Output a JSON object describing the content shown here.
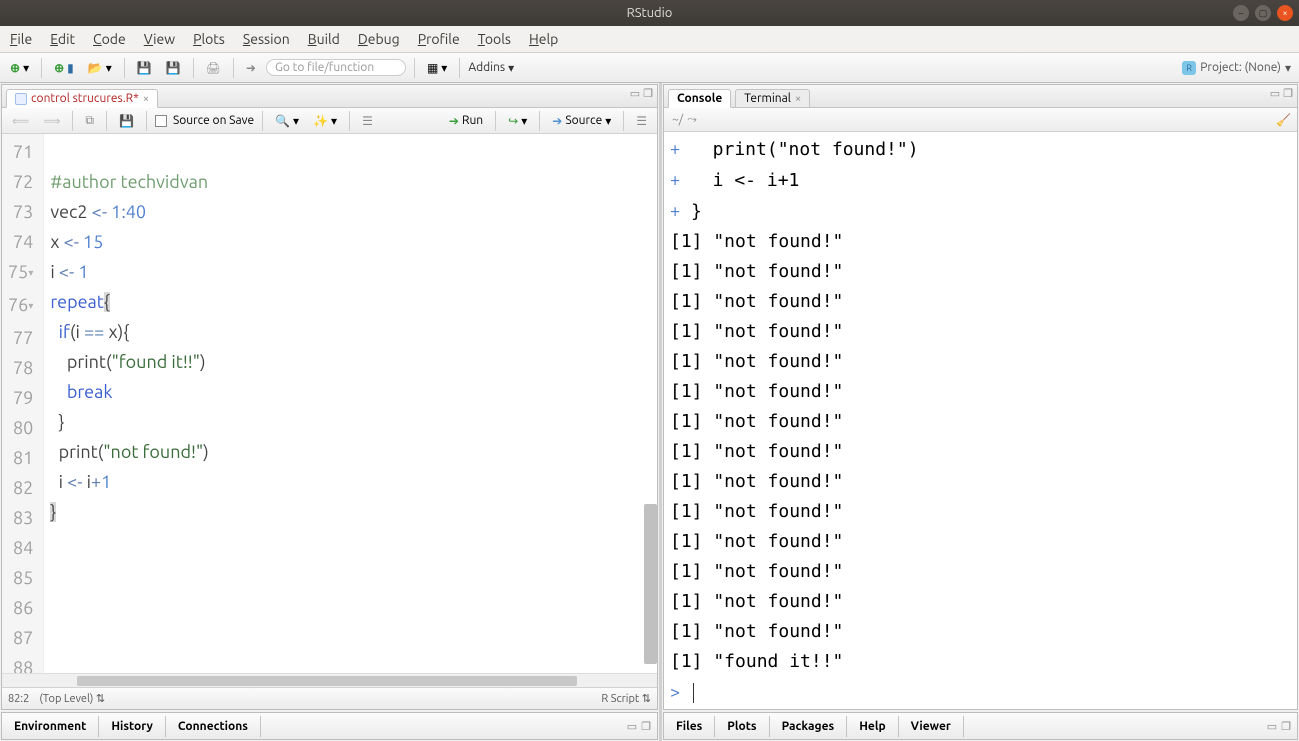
{
  "window": {
    "title": "RStudio"
  },
  "menu": {
    "file": "File",
    "edit": "Edit",
    "code": "Code",
    "view": "View",
    "plots": "Plots",
    "session": "Session",
    "build": "Build",
    "debug": "Debug",
    "profile": "Profile",
    "tools": "Tools",
    "help": "Help"
  },
  "toolbar": {
    "goto_placeholder": "Go to file/function",
    "addins": "Addins",
    "project": "Project: (None)"
  },
  "source": {
    "tab_name": "control strucures.R",
    "tab_dirty": "*",
    "source_on_save": "Source on Save",
    "run": "Run",
    "source_btn": "Source",
    "lines": [
      {
        "n": 71,
        "raw": "#author techvidvan",
        "type": "comment"
      },
      {
        "n": 72
      },
      {
        "n": 73
      },
      {
        "n": 74
      },
      {
        "n": 75
      },
      {
        "n": 76
      },
      {
        "n": 77
      },
      {
        "n": 78
      },
      {
        "n": 79
      },
      {
        "n": 80
      },
      {
        "n": 81
      },
      {
        "n": 82
      },
      {
        "n": 83
      },
      {
        "n": 84
      },
      {
        "n": 85
      },
      {
        "n": 86
      },
      {
        "n": 87
      },
      {
        "n": 88
      }
    ],
    "tokens": {
      "vec2": "vec2 ",
      "assign": "<-",
      "range": "1",
      "colon": ":",
      "forty": "40",
      "x": "x ",
      "fifteen": "15",
      "i": "i ",
      "one": "1",
      "repeat": "repeat",
      "lbr": "{",
      "if": "if",
      "lp": "(",
      "eqeq": " == ",
      "rp": ")",
      "lbr2": "{",
      "print": "print",
      "q": "\"",
      "found": "found it!!",
      "qend": "\"",
      "break": "break",
      "rbr": "}",
      "notfound": "not found!",
      "iplus": "i",
      "plus": "+",
      "one2": "1",
      "rbr2": "}"
    },
    "status_pos": "82:2",
    "status_scope": "(Top Level)",
    "status_mode": "R Script"
  },
  "console": {
    "tab_console": "Console",
    "tab_terminal": "Terminal",
    "cwd": "~/",
    "echo": [
      "   print(\"not found!\")",
      "   i <- i+1",
      " }"
    ],
    "out_notfound": "[1] \"not found!\"",
    "out_found": "[1] \"found it!!\"",
    "notfound_count": 14,
    "prompt": ">"
  },
  "bottom_left": {
    "environment": "Environment",
    "history": "History",
    "connections": "Connections"
  },
  "bottom_right": {
    "files": "Files",
    "plots": "Plots",
    "packages": "Packages",
    "help": "Help",
    "viewer": "Viewer"
  }
}
